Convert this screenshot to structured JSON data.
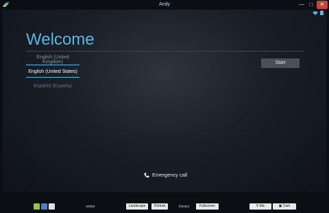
{
  "window": {
    "title": "Andy",
    "icon": "andy-logo-icon",
    "controls": {
      "minimize": "—",
      "maximize": "□",
      "close": "✕"
    }
  },
  "status_bar": {
    "icons": [
      "wifi-icon",
      "battery-icon"
    ]
  },
  "welcome": {
    "title": "Welcome",
    "languages": [
      "English (United Kingdom)",
      "English (United States)",
      "Español (España)"
    ],
    "selected_index": 1,
    "start_label": "Start",
    "emergency_label": "Emergency call"
  },
  "toolbar": {
    "icons": [
      "android-icon",
      "apps-icon",
      "menu-icon"
    ],
    "status": "online",
    "landscape": "Landscape",
    "portrait": "Portrait",
    "device": "Device",
    "fullscreen": "Fullscreen",
    "mic": "Mic",
    "cam": "Cam"
  },
  "colors": {
    "accent": "#56b6e6",
    "title_bar": "#0b0f14",
    "close_button": "#c7463a"
  }
}
